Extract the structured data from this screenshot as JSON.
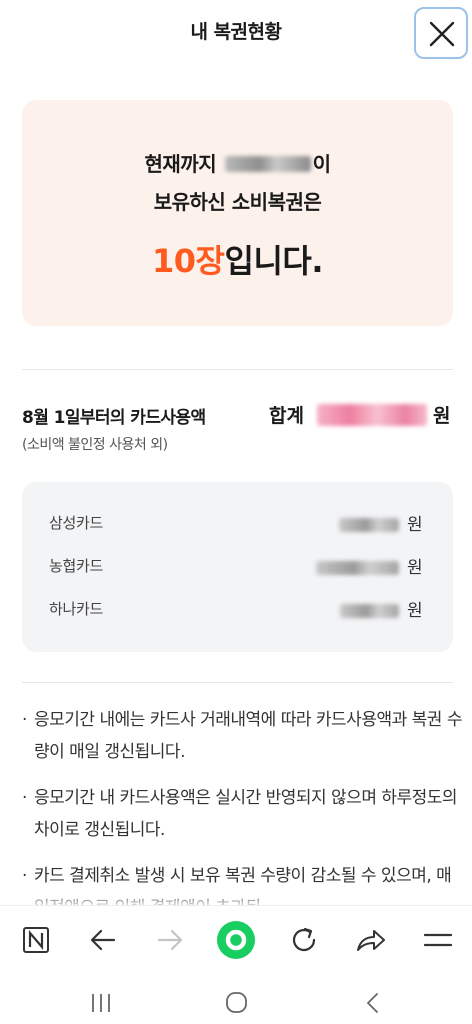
{
  "header": {
    "title": "내 복권현황",
    "close_icon": "close-icon"
  },
  "summary": {
    "line1_prefix": "현재까지",
    "line1_suffix": "이",
    "line2": "보유하신 소비복권은",
    "count": "10장",
    "count_suffix": "입니다.",
    "accent_color": "#ff5a1f",
    "background_color": "#fdf1ec"
  },
  "usage": {
    "title": "8월 1일부터의 카드사용액",
    "subtitle": "(소비액 불인정 사용처 외)",
    "total_label": "합계",
    "total_unit": "원",
    "cards": [
      {
        "name": "삼성카드",
        "unit": "원"
      },
      {
        "name": "농협카드",
        "unit": "원"
      },
      {
        "name": "하나카드",
        "unit": "원"
      }
    ]
  },
  "notices": [
    {
      "bullet": "·",
      "text": "응모기간 내에는 카드사 거래내역에 따라 카드사용액과 복권 수량이 매일 갱신됩니다."
    },
    {
      "bullet": "·",
      "text": "응모기간 내 카드사용액은 실시간 반영되지 않으며 하루정도의 차이로 갱신됩니다."
    },
    {
      "bullet": "·",
      "text": "카드 결제취소 발생 시 보유 복권 수량이 감소될 수 있으며, 매일정액으로 인해 결제액이 초과된"
    }
  ],
  "toolbar": {
    "icons": [
      "naver-n-icon",
      "back-arrow-icon",
      "forward-arrow-icon",
      "home-green-circle-icon",
      "refresh-icon",
      "share-icon",
      "menu-icon"
    ],
    "brand_color": "#19ce60"
  },
  "system_nav": {
    "icons": [
      "recent-apps-icon",
      "home-icon",
      "back-icon"
    ]
  }
}
